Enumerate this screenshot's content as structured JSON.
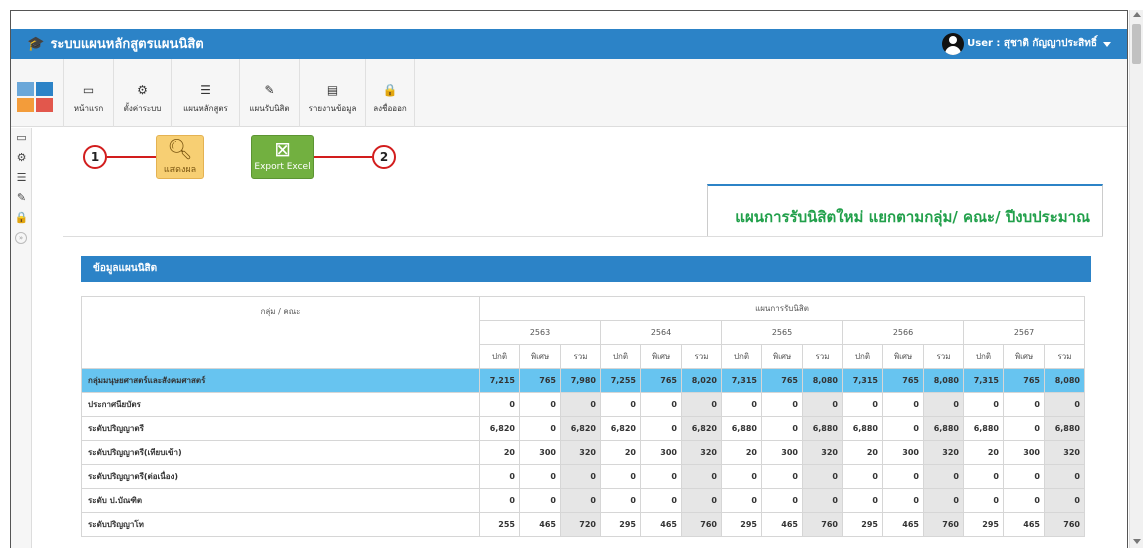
{
  "app": {
    "title": "ระบบแผนหลักสูตรแผนนิสิต",
    "user_label": "User : สุชาติ กัญญาประสิทธิ์"
  },
  "menu": [
    {
      "label": "หน้าแรก",
      "icon": "monitor-icon",
      "glyph": "▭"
    },
    {
      "label": "ตั้งค่าระบบ",
      "icon": "gears-icon",
      "glyph": "⚙"
    },
    {
      "label": "แผนหลักสูตร",
      "icon": "list-icon",
      "glyph": "☰"
    },
    {
      "label": "แผนรับนิสิต",
      "icon": "edit-icon",
      "glyph": "✎"
    },
    {
      "label": "รายงานข้อมูล",
      "icon": "report-icon",
      "glyph": "▤"
    },
    {
      "label": "ลงชื่อออก",
      "icon": "lock-icon",
      "glyph": "🔒"
    }
  ],
  "sidebar_icons": [
    "monitor-icon",
    "gears-icon",
    "list-icon",
    "edit-icon",
    "lock-icon",
    "expand-icon"
  ],
  "actions": {
    "show_label": "แสดงผล",
    "export_label": "Export Excel",
    "callout_1": "1",
    "callout_2": "2"
  },
  "heading": "แผนการรับนิสิตใหม่ แยกตามกลุ่ม/ คณะ/ ปีงบประมาณ",
  "panel_title": "ข้อมูลแผนนิสิต",
  "table": {
    "col_group_label": "กลุ่ม / คณะ",
    "plan_label": "แผนการรับนิสิต",
    "years": [
      "2563",
      "2564",
      "2565",
      "2566",
      "2567"
    ],
    "sub_headers": [
      "ปกติ",
      "พิเศษ",
      "รวม"
    ],
    "rows": [
      {
        "label": "กลุ่มมนุษยศาสตร์และสังคมศาสตร์",
        "group": true,
        "values": [
          "7,215",
          "765",
          "7,980",
          "7,255",
          "765",
          "8,020",
          "7,315",
          "765",
          "8,080",
          "7,315",
          "765",
          "8,080",
          "7,315",
          "765",
          "8,080"
        ]
      },
      {
        "label": "ประกาศนียบัตร",
        "group": false,
        "values": [
          "0",
          "0",
          "0",
          "0",
          "0",
          "0",
          "0",
          "0",
          "0",
          "0",
          "0",
          "0",
          "0",
          "0",
          "0"
        ]
      },
      {
        "label": "ระดับปริญญาตรี",
        "group": false,
        "values": [
          "6,820",
          "0",
          "6,820",
          "6,820",
          "0",
          "6,820",
          "6,880",
          "0",
          "6,880",
          "6,880",
          "0",
          "6,880",
          "6,880",
          "0",
          "6,880"
        ]
      },
      {
        "label": "ระดับปริญญาตรี(เทียบเข้า)",
        "group": false,
        "values": [
          "20",
          "300",
          "320",
          "20",
          "300",
          "320",
          "20",
          "300",
          "320",
          "20",
          "300",
          "320",
          "20",
          "300",
          "320"
        ]
      },
      {
        "label": "ระดับปริญญาตรี(ต่อเนื่อง)",
        "group": false,
        "values": [
          "0",
          "0",
          "0",
          "0",
          "0",
          "0",
          "0",
          "0",
          "0",
          "0",
          "0",
          "0",
          "0",
          "0",
          "0"
        ]
      },
      {
        "label": "ระดับ ป.บัณฑิต",
        "group": false,
        "values": [
          "0",
          "0",
          "0",
          "0",
          "0",
          "0",
          "0",
          "0",
          "0",
          "0",
          "0",
          "0",
          "0",
          "0",
          "0"
        ]
      },
      {
        "label": "ระดับปริญญาโท",
        "group": false,
        "values": [
          "255",
          "465",
          "720",
          "295",
          "465",
          "760",
          "295",
          "465",
          "760",
          "295",
          "465",
          "760",
          "295",
          "465",
          "760"
        ]
      }
    ]
  },
  "colors": {
    "brand_blue": "#2c83c7",
    "group_row": "#67c4f0",
    "sum_cell": "#e6e6e6",
    "heading_green": "#22a04b",
    "callout_red": "#d21d1d"
  }
}
